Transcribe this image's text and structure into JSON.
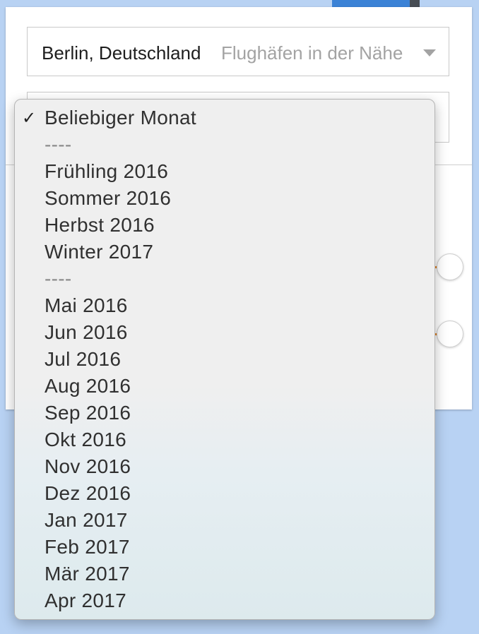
{
  "search": {
    "origin_value": "Berlin, Deutschland",
    "nearby_airports_label": "Flughäfen in der Nähe"
  },
  "month_dropdown": {
    "selected": "Beliebiger Monat",
    "items": [
      {
        "label": "Beliebiger Monat",
        "checked": true
      },
      {
        "label": "----"
      },
      {
        "label": "Frühling 2016"
      },
      {
        "label": "Sommer 2016"
      },
      {
        "label": "Herbst 2016"
      },
      {
        "label": "Winter 2017"
      },
      {
        "label": "----"
      },
      {
        "label": "Mai 2016"
      },
      {
        "label": "Jun 2016"
      },
      {
        "label": "Jul 2016"
      },
      {
        "label": "Aug 2016"
      },
      {
        "label": "Sep 2016"
      },
      {
        "label": "Okt 2016"
      },
      {
        "label": "Nov 2016"
      },
      {
        "label": "Dez 2016"
      },
      {
        "label": "Jan 2017"
      },
      {
        "label": "Feb 2017"
      },
      {
        "label": "Mär 2017"
      },
      {
        "label": "Apr 2017"
      }
    ],
    "check_glyph": "✓"
  },
  "colors": {
    "slider_accent": "#e88a2b",
    "map_water": "#b8d2f3"
  }
}
